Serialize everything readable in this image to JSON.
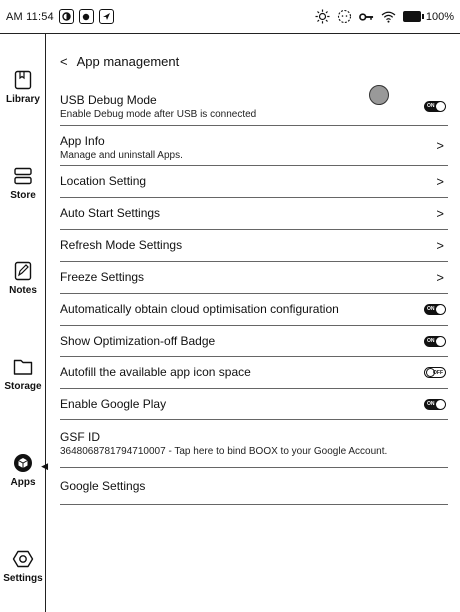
{
  "status": {
    "time": "AM 11:54",
    "battery": "100%"
  },
  "sidebar": {
    "items": [
      {
        "label": "Library",
        "icon": "library-icon"
      },
      {
        "label": "Store",
        "icon": "store-icon"
      },
      {
        "label": "Notes",
        "icon": "notes-icon"
      },
      {
        "label": "Storage",
        "icon": "folder-icon"
      },
      {
        "label": "Apps",
        "icon": "apps-icon",
        "active": true
      },
      {
        "label": "Settings",
        "icon": "settings-icon"
      }
    ]
  },
  "page": {
    "title": "App management"
  },
  "settings": {
    "usb_debug": {
      "title": "USB Debug Mode",
      "subtitle": "Enable Debug mode after USB is connected",
      "state": "ON"
    },
    "app_info": {
      "title": "App Info",
      "subtitle": "Manage and uninstall Apps."
    },
    "location": {
      "title": "Location Setting"
    },
    "auto_start": {
      "title": "Auto Start Settings"
    },
    "refresh_mode": {
      "title": "Refresh Mode Settings"
    },
    "freeze": {
      "title": "Freeze Settings"
    },
    "cloud_opt": {
      "title": "Automatically obtain cloud optimisation configuration",
      "state": "ON"
    },
    "opt_badge": {
      "title": "Show Optimization-off Badge",
      "state": "ON"
    },
    "autofill_icon": {
      "title": "Autofill the available app icon space",
      "state": "OFF"
    },
    "google_play": {
      "title": "Enable Google Play",
      "state": "ON"
    },
    "gsf_id": {
      "title": "GSF ID",
      "subtitle": "3648068781794710007 - Tap here to bind BOOX to your Google Account."
    },
    "google_settings": {
      "title": "Google Settings"
    }
  }
}
